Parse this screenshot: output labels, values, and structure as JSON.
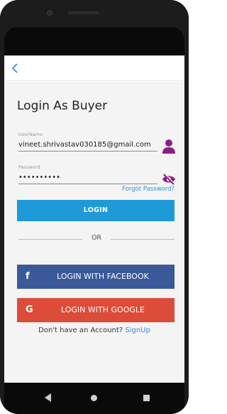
{
  "screen": {
    "title": "Login As Buyer",
    "username": {
      "label": "UserName",
      "value": "vineet.shrivastav030185@gmail.com"
    },
    "password": {
      "label": "Password",
      "value": "••••••••••"
    },
    "forgot_password": "Forgot Password?",
    "login_button": "LOGIN",
    "or_text": "OR",
    "facebook_button": "LOGIN WITH FACEBOOK",
    "facebook_icon": "f",
    "google_button": "LOGIN WITH GOOGLE",
    "google_icon": "G",
    "signup_prompt": "Don't have an Account?",
    "signup_link": "SignUp"
  },
  "colors": {
    "accent": "#1f9ad9",
    "facebook": "#3b5998",
    "google": "#dd4b39",
    "link": "#2c8ee0",
    "icon": "#8b1f86"
  },
  "icons": [
    "back-icon",
    "user-icon",
    "eye-off-icon",
    "facebook-icon",
    "google-icon",
    "nav-back-icon",
    "nav-home-icon",
    "nav-recent-icon"
  ]
}
